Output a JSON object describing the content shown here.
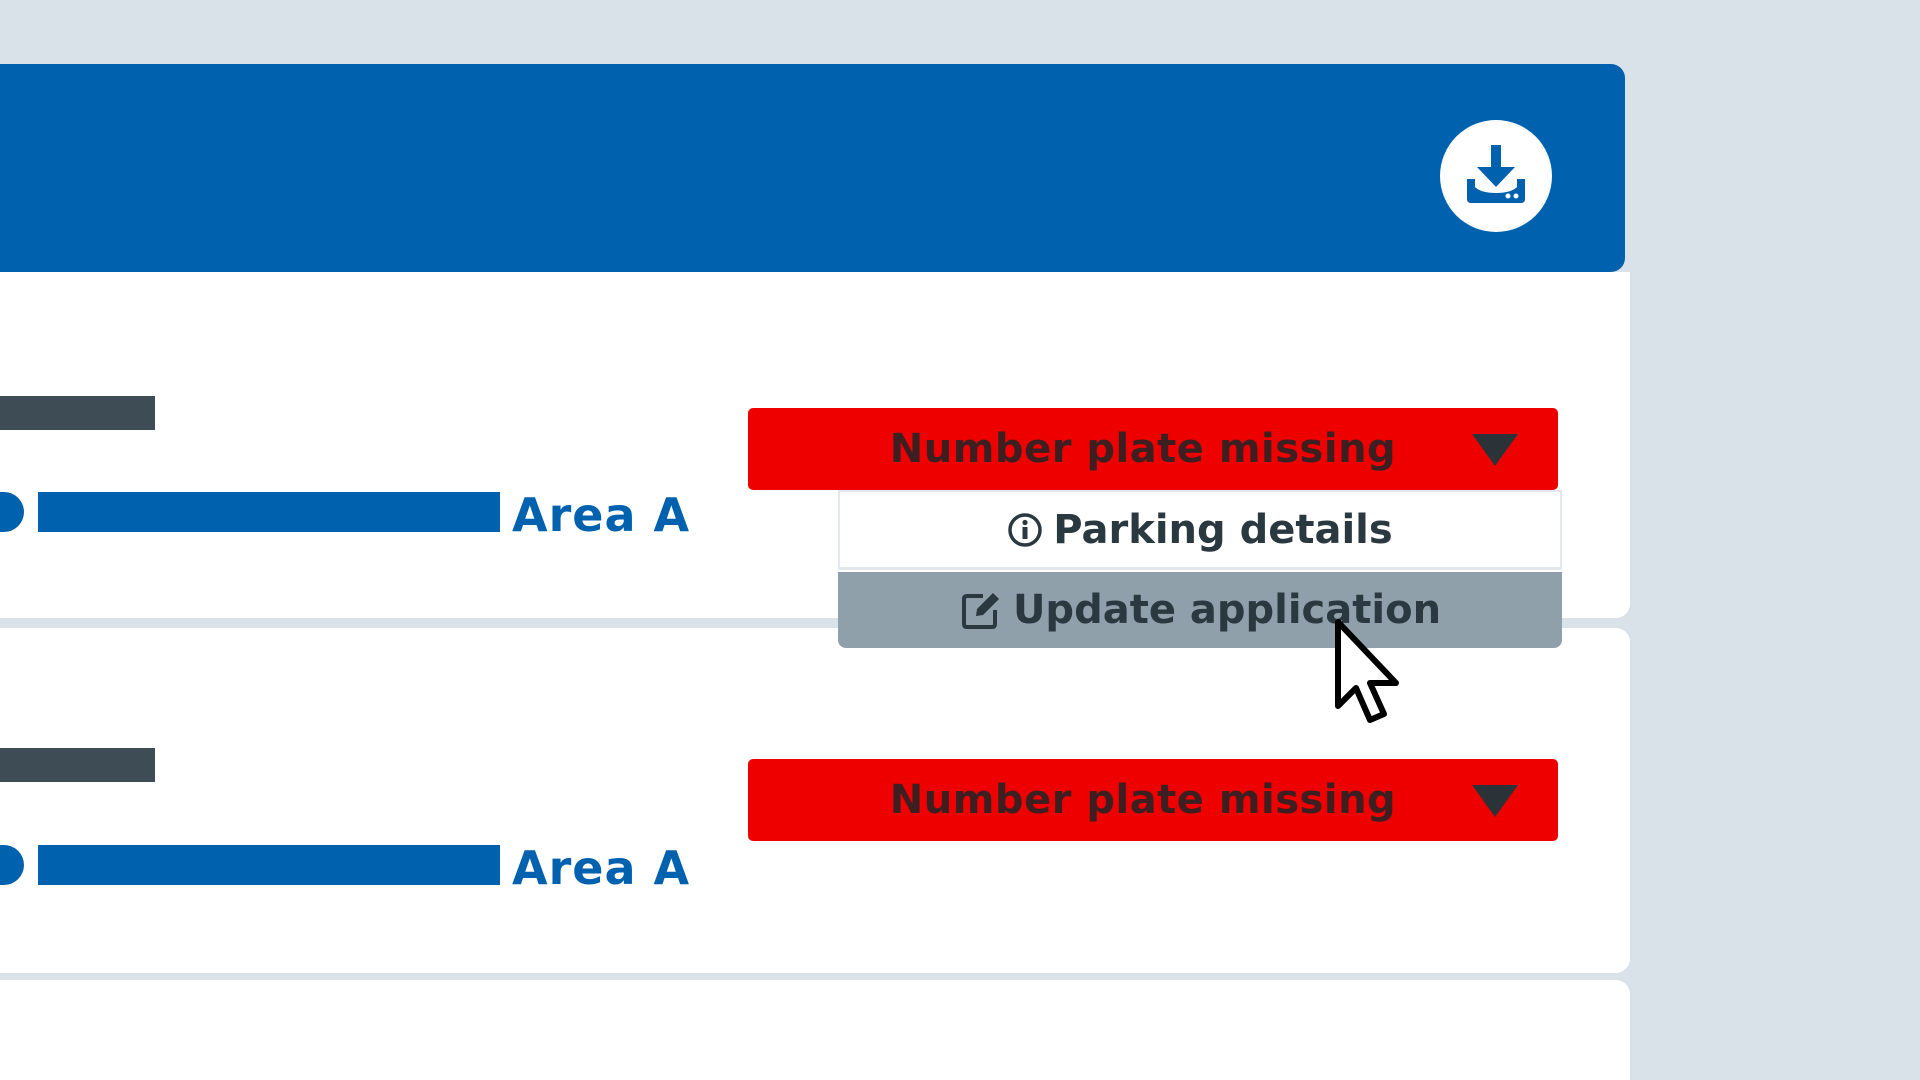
{
  "header": {
    "download_icon": "download-icon"
  },
  "rows": [
    {
      "area_label": "Area A",
      "status_label": "Number plate missing"
    },
    {
      "area_label": "Area A",
      "status_label": "Number plate missing"
    }
  ],
  "menu": {
    "items": [
      {
        "label": "Parking details",
        "icon": "info-icon",
        "state": "normal"
      },
      {
        "label": "Update application",
        "icon": "edit-icon",
        "state": "hover"
      }
    ]
  },
  "colors": {
    "background": "#d8e2e8",
    "primary_blue": "#0061af",
    "status_red": "#ee0000",
    "menu_hover": "#8fa0aa",
    "dark_text": "#2a3840"
  }
}
